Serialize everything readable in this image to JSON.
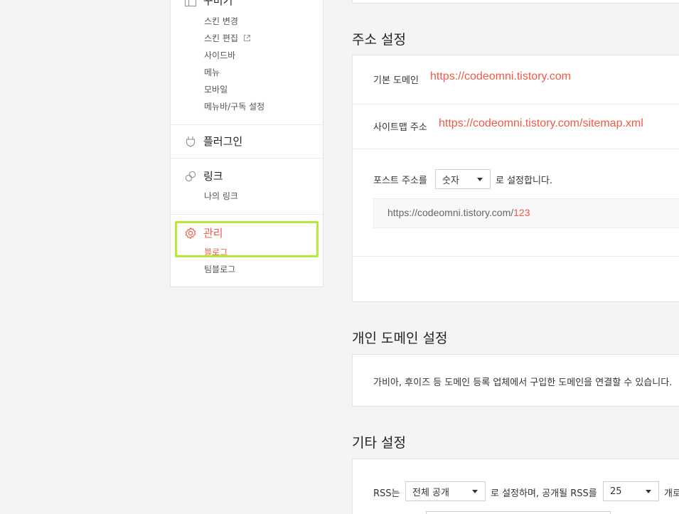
{
  "sidebar": {
    "design": {
      "title": "꾸미기",
      "items": [
        "스킨 변경",
        "스킨 편집",
        "사이드바",
        "메뉴",
        "모바일",
        "메뉴바/구독 설정"
      ]
    },
    "plugin": {
      "title": "플러그인"
    },
    "link": {
      "title": "링크",
      "items": [
        "나의 링크"
      ]
    },
    "manage": {
      "title": "관리",
      "items": [
        "블로그",
        "팀블로그"
      ]
    }
  },
  "address": {
    "section_title": "주소 설정",
    "basic_domain_label": "기본 도메인",
    "basic_domain_value": "https://codeomni.tistory.com",
    "sitemap_label": "사이트맵 주소",
    "sitemap_value": "https://codeomni.tistory.com/sitemap.xml",
    "post_address_prefix": "포스트 주소를",
    "post_address_select": "숫자",
    "post_address_suffix": "로 설정합니다.",
    "preview_base": "https://codeomni.tistory.com/",
    "preview_number": "123"
  },
  "personal_domain": {
    "section_title": "개인 도메인 설정",
    "description": "가비아, 후이즈 등 도메인 등록 업체에서 구입한 도메인을 연결할 수 있습니다."
  },
  "other": {
    "section_title": "기타 설정",
    "rss_label": "RSS는",
    "rss_select": "전체 공개",
    "rss_middle": "로 설정하며, 공개될 RSS를",
    "rss_count_select": "25",
    "rss_suffix": "개로"
  },
  "colors": {
    "accent": "#f05a45",
    "highlight": "#b5ea3a"
  }
}
